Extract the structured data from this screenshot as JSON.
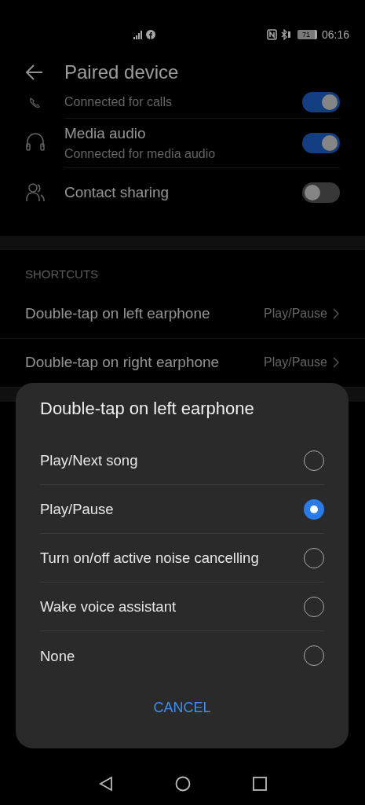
{
  "status_bar": {
    "battery": "71",
    "time": "06:16"
  },
  "header": {
    "title": "Paired device"
  },
  "devices": [
    {
      "kind": "call",
      "subtitle": "Connected for calls",
      "on": true
    },
    {
      "kind": "headphones",
      "title": "Media audio",
      "subtitle": "Connected for media audio",
      "on": true
    },
    {
      "kind": "contacts",
      "title": "Contact sharing",
      "on": false
    }
  ],
  "shortcuts": {
    "heading": "SHORTCUTS",
    "rows": [
      {
        "label": "Double-tap on left earphone",
        "value": "Play/Pause"
      },
      {
        "label": "Double-tap on right earphone",
        "value": "Play/Pause"
      }
    ]
  },
  "dialog": {
    "title": "Double-tap on left earphone",
    "options": [
      {
        "label": "Play/Next song",
        "selected": false
      },
      {
        "label": "Play/Pause",
        "selected": true
      },
      {
        "label": "Turn on/off active noise cancelling",
        "selected": false
      },
      {
        "label": "Wake voice assistant",
        "selected": false
      },
      {
        "label": "None",
        "selected": false
      }
    ],
    "cancel": "CANCEL"
  }
}
